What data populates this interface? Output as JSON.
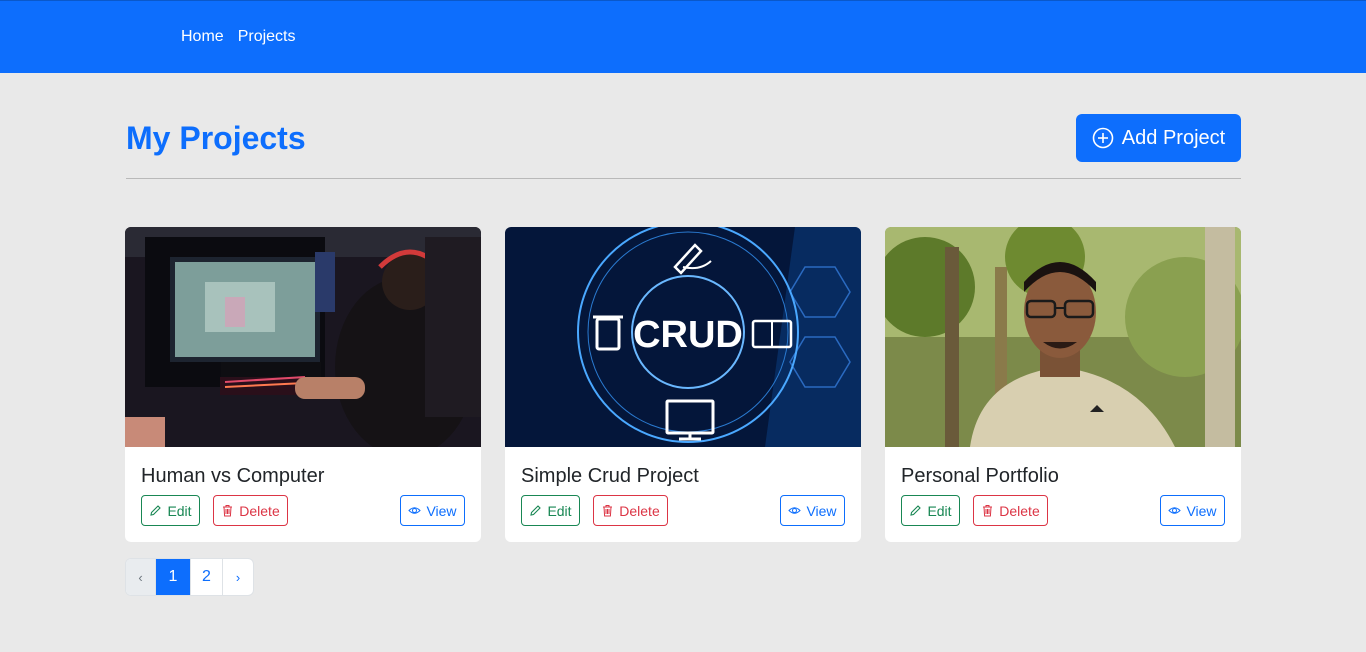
{
  "nav": {
    "home": "Home",
    "projects": "Projects"
  },
  "header": {
    "title": "My Projects",
    "add_label": "Add Project"
  },
  "cards": [
    {
      "title": "Human vs Computer",
      "edit": "Edit",
      "delete": "Delete",
      "view": "View"
    },
    {
      "title": "Simple Crud Project",
      "edit": "Edit",
      "delete": "Delete",
      "view": "View",
      "image_text": "CRUD"
    },
    {
      "title": "Personal Portfolio",
      "edit": "Edit",
      "delete": "Delete",
      "view": "View"
    }
  ],
  "pagination": {
    "prev": "‹",
    "pages": [
      "1",
      "2"
    ],
    "next": "›",
    "active": "1"
  },
  "colors": {
    "primary": "#0d6efd",
    "success": "#198754",
    "danger": "#dc3545",
    "background": "#e9e9e9"
  }
}
